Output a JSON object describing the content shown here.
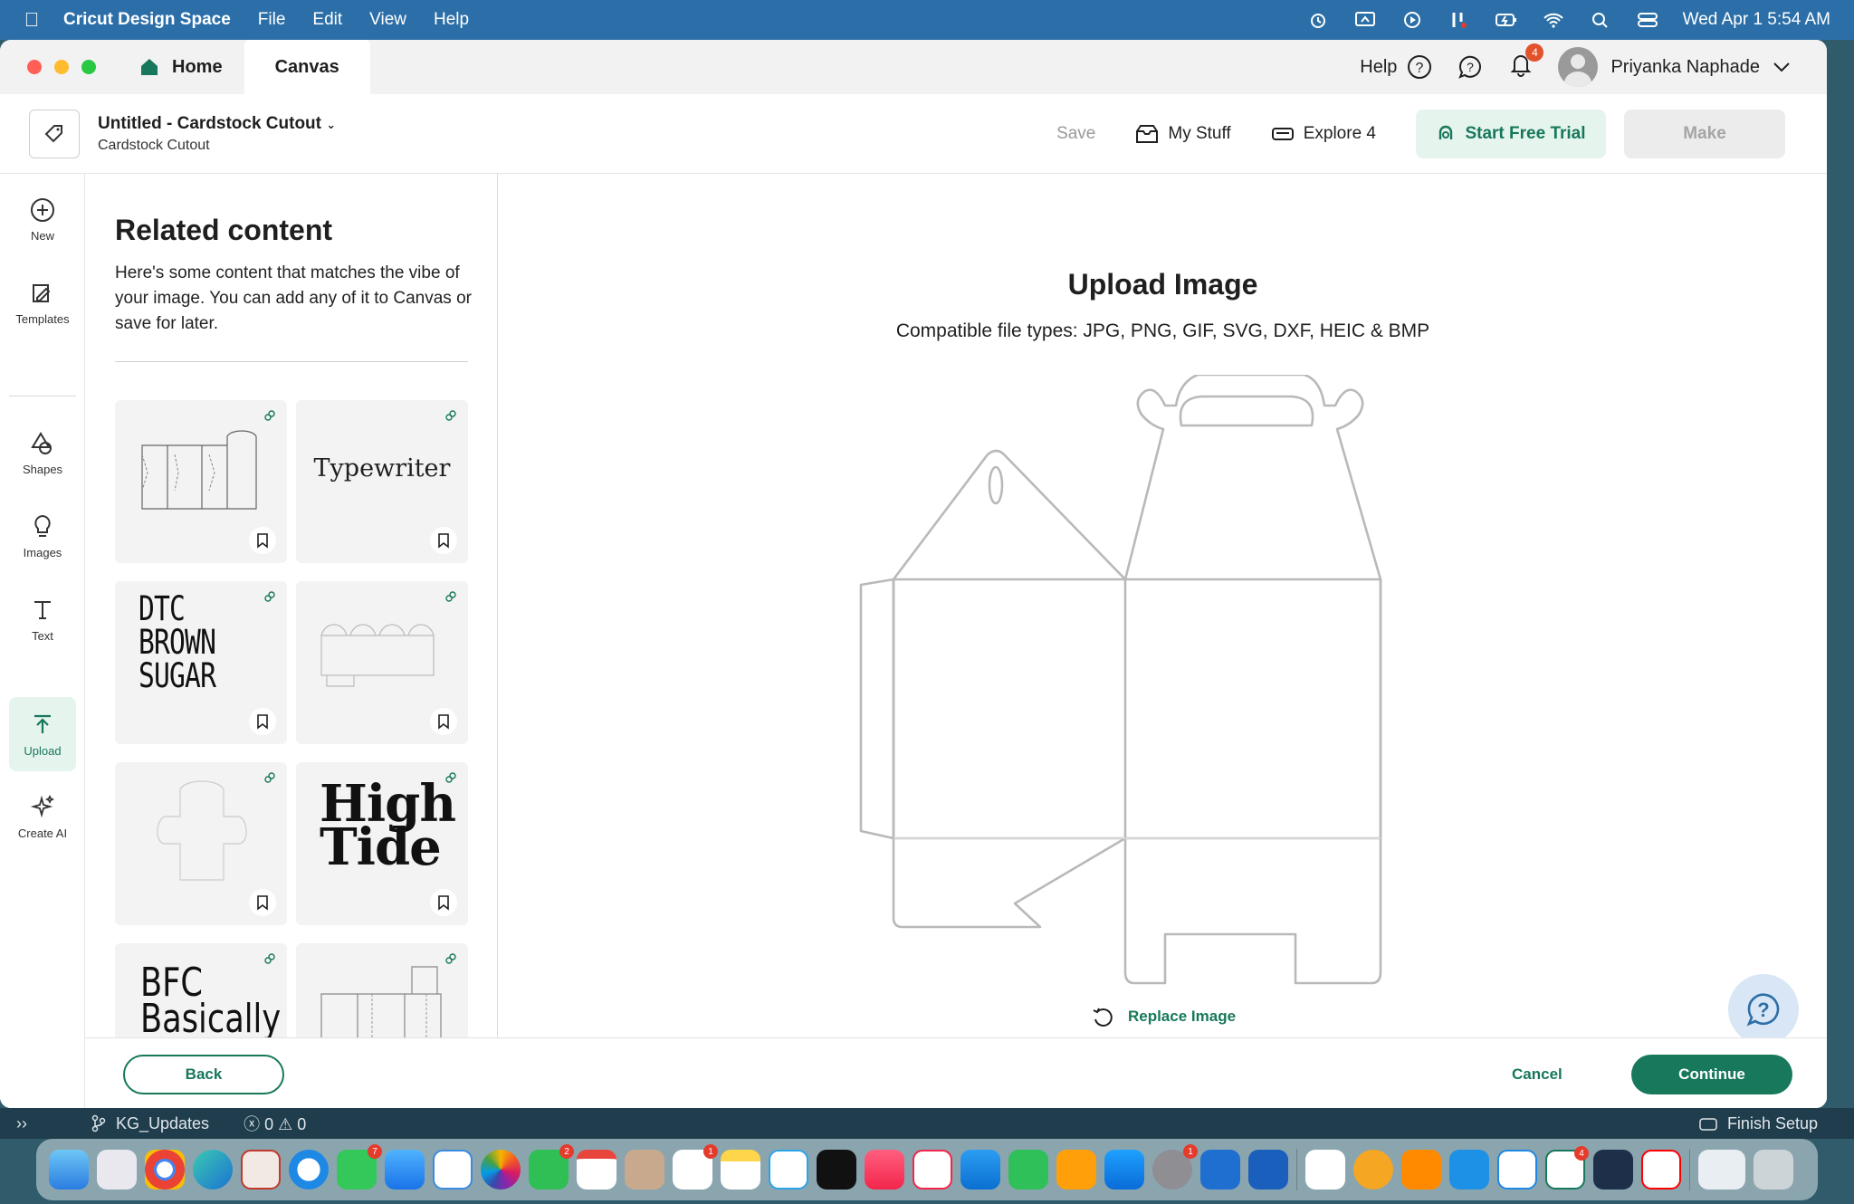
{
  "menubar": {
    "app_name": "Cricut Design Space",
    "menus": [
      "File",
      "Edit",
      "View",
      "Help"
    ],
    "datetime": "Wed Apr 1  5:54 AM"
  },
  "titlebar": {
    "home_tab": "Home",
    "canvas_tab": "Canvas",
    "help_label": "Help",
    "notification_count": "4",
    "user_name": "Priyanka Naphade"
  },
  "project": {
    "title": "Untitled - Cardstock Cutout",
    "subtitle": "Cardstock Cutout",
    "save_label": "Save",
    "my_stuff_label": "My Stuff",
    "explore_label": "Explore 4",
    "trial_label": "Start Free Trial",
    "make_label": "Make"
  },
  "toolbar": {
    "items": [
      {
        "label": "New",
        "icon": "plus-circle-icon"
      },
      {
        "label": "Templates",
        "icon": "templates-icon"
      },
      {
        "label": "Shapes",
        "icon": "shapes-icon"
      },
      {
        "label": "Images",
        "icon": "lightbulb-icon"
      },
      {
        "label": "Text",
        "icon": "text-icon"
      },
      {
        "label": "Upload",
        "icon": "upload-icon"
      },
      {
        "label": "Create AI",
        "icon": "sparkle-icon"
      }
    ],
    "active": "Upload"
  },
  "related": {
    "heading": "Related content",
    "description": "Here's some content that matches the vibe of your image. You can add any of it to Canvas or save for later.",
    "cards": [
      {
        "kind": "box-template",
        "text": ""
      },
      {
        "kind": "font",
        "text": "Typewriter"
      },
      {
        "kind": "font",
        "text": "DTC BROWN SUGAR"
      },
      {
        "kind": "box-template",
        "text": ""
      },
      {
        "kind": "box-template",
        "text": ""
      },
      {
        "kind": "font",
        "text": "High Tide"
      },
      {
        "kind": "font",
        "text": "BFC Basically"
      },
      {
        "kind": "box-template",
        "text": ""
      }
    ]
  },
  "upload": {
    "title": "Upload Image",
    "subtitle": "Compatible file types:  JPG, PNG, GIF, SVG, DXF, HEIC & BMP",
    "replace_label": "Replace Image"
  },
  "footer": {
    "back_label": "Back",
    "cancel_label": "Cancel",
    "continue_label": "Continue"
  },
  "background_editor": {
    "branch": "KG_Updates",
    "problems": "ⓧ 0 ⚠ 0",
    "finish_setup": "Finish Setup"
  },
  "dock": {
    "badges": {
      "messages": "7",
      "facetime": "2",
      "reminders": "1",
      "settings": "1",
      "cricut": "4"
    }
  },
  "colors": {
    "accent": "#17785b",
    "accent_light": "#e6f4ee",
    "menubar": "#2c6fa8"
  }
}
